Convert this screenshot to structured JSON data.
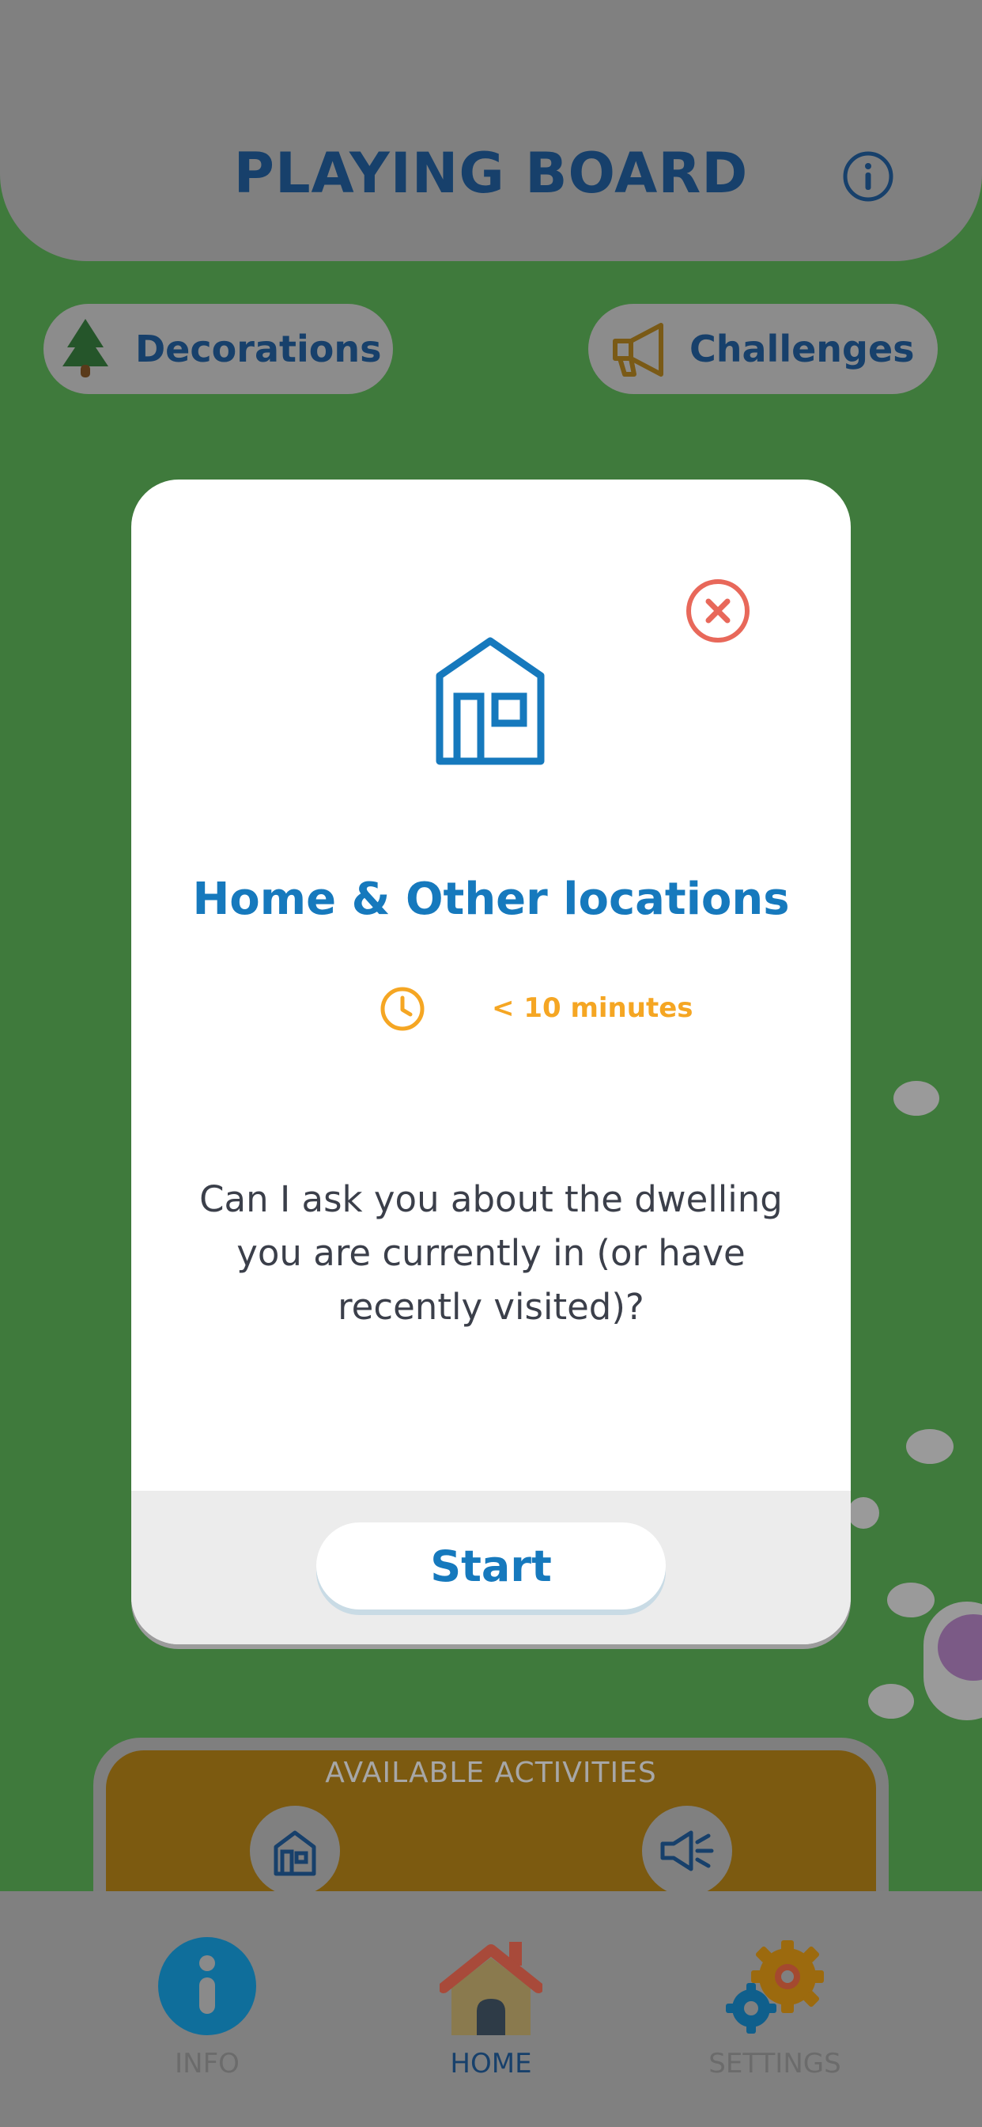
{
  "header": {
    "title": "PLAYING BOARD"
  },
  "top_buttons": {
    "decorations_label": "Decorations",
    "challenges_label": "Challenges"
  },
  "activities": {
    "title": "AVAILABLE ACTIVITIES",
    "items": [
      "house-icon",
      "megaphone-icon"
    ]
  },
  "modal": {
    "title": "Home & Other locations",
    "duration": "< 10 minutes",
    "question": "Can I ask you about the dwelling you are currently in (or have recently visited)?",
    "start_label": "Start",
    "accent_color": "#1679bd",
    "duration_color": "#f5a623",
    "close_color": "#e8685a"
  },
  "bottom_nav": {
    "items": [
      {
        "label": "INFO",
        "icon": "info-icon"
      },
      {
        "label": "HOME",
        "icon": "home-icon",
        "active": true
      },
      {
        "label": "SETTINGS",
        "icon": "gear-icon"
      }
    ]
  }
}
